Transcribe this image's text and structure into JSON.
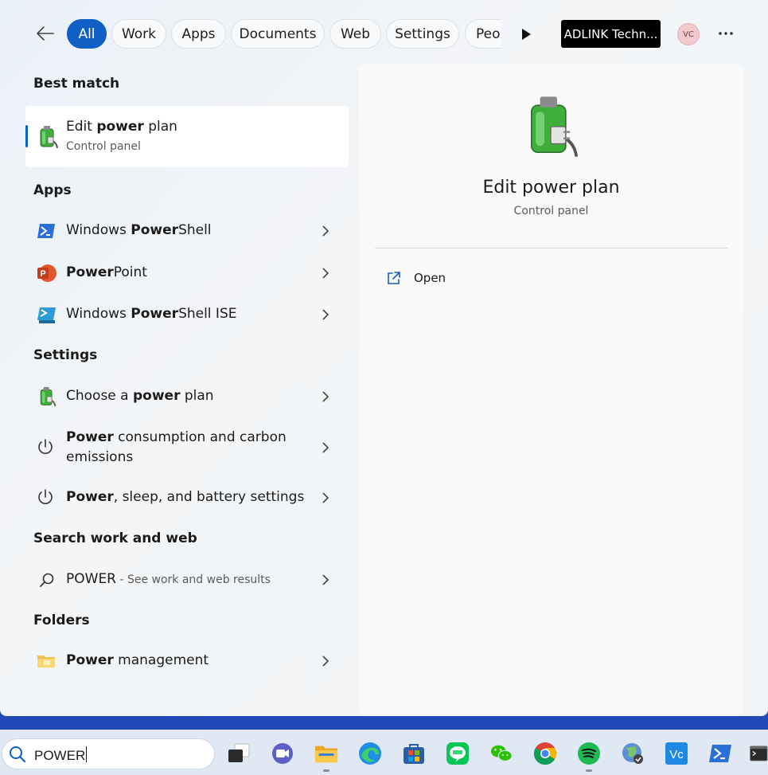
{
  "filter_bar": {
    "tabs": [
      {
        "label": "All"
      },
      {
        "label": "Work"
      },
      {
        "label": "Apps"
      },
      {
        "label": "Documents"
      },
      {
        "label": "Web"
      },
      {
        "label": "Settings"
      },
      {
        "label": "Peop"
      }
    ],
    "org_label": "ADLINK Techn...",
    "avatar_initials": "VC"
  },
  "best_match": {
    "heading": "Best match",
    "title_pre": "Edit ",
    "title_bold": "power",
    "title_post": " plan",
    "subtitle": "Control panel"
  },
  "apps": {
    "heading": "Apps",
    "items": [
      {
        "pre": "Windows ",
        "bold": "Power",
        "post": "Shell"
      },
      {
        "pre": "",
        "bold": "Power",
        "post": "Point"
      },
      {
        "pre": "Windows ",
        "bold": "Power",
        "post": "Shell ISE"
      }
    ]
  },
  "settings": {
    "heading": "Settings",
    "items": [
      {
        "pre": "Choose a ",
        "bold": "power",
        "post": " plan"
      },
      {
        "pre": "",
        "bold": "Power",
        "post": " consumption and carbon",
        "line2": "emissions"
      },
      {
        "pre": "",
        "bold": "Power",
        "post": ", sleep, and battery settings"
      }
    ]
  },
  "web": {
    "heading": "Search work and web",
    "query": "POWER",
    "hint": " - See work and web results"
  },
  "folders": {
    "heading": "Folders",
    "items": [
      {
        "pre": "",
        "bold": "Power",
        "post": " management"
      }
    ]
  },
  "detail": {
    "title": "Edit power plan",
    "subtitle": "Control panel",
    "open_label": "Open"
  },
  "taskbar": {
    "search_value": "POWER",
    "accent": "#0f5fc5"
  }
}
